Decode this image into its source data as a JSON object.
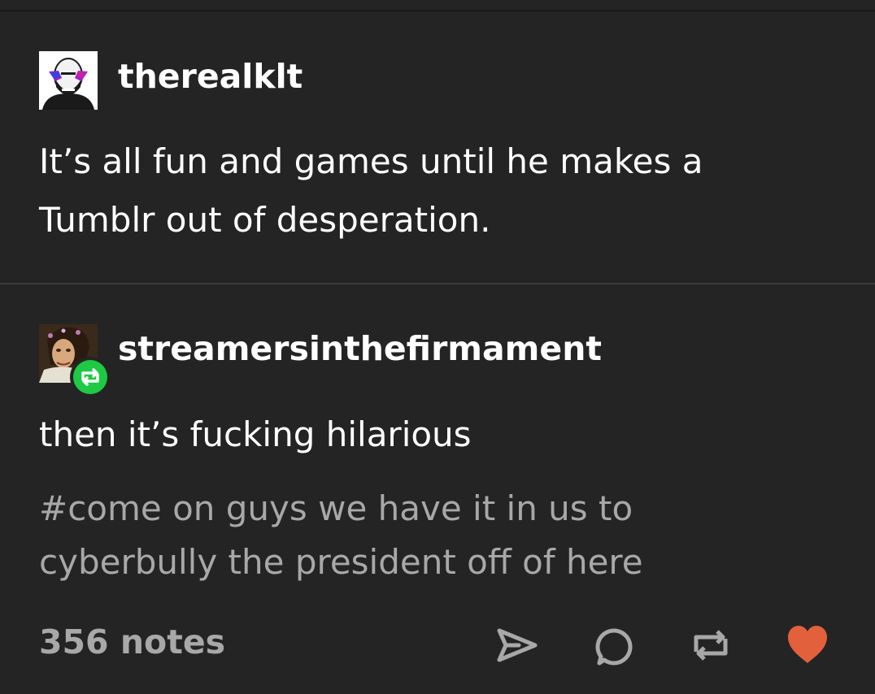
{
  "posts": [
    {
      "username": "therealklt",
      "avatar_icon": "bald-man-sunglasses-avatar",
      "lines": [
        "It’s all fun and games until he makes a",
        "Tumblr out of desperation."
      ]
    },
    {
      "username": "streamersinthefirmament",
      "avatar_icon": "painted-portrait-avatar",
      "badge_icon": "reblog-icon",
      "lines": [
        "then it’s fucking hilarious"
      ],
      "tags": [
        "#come on guys we have it in us to",
        "cyberbully the president off of here"
      ]
    }
  ],
  "footer": {
    "notes": "356 notes",
    "actions": [
      {
        "name": "share",
        "icon": "paper-plane-icon"
      },
      {
        "name": "reply",
        "icon": "speech-bubble-icon"
      },
      {
        "name": "reblog",
        "icon": "reblog-icon"
      },
      {
        "name": "like",
        "icon": "heart-icon"
      }
    ]
  },
  "colors": {
    "background": "#242424",
    "text": "#ffffff",
    "muted": "#a8a8a8",
    "reblog_green": "#1ec944",
    "like_red": "#e2603c"
  }
}
